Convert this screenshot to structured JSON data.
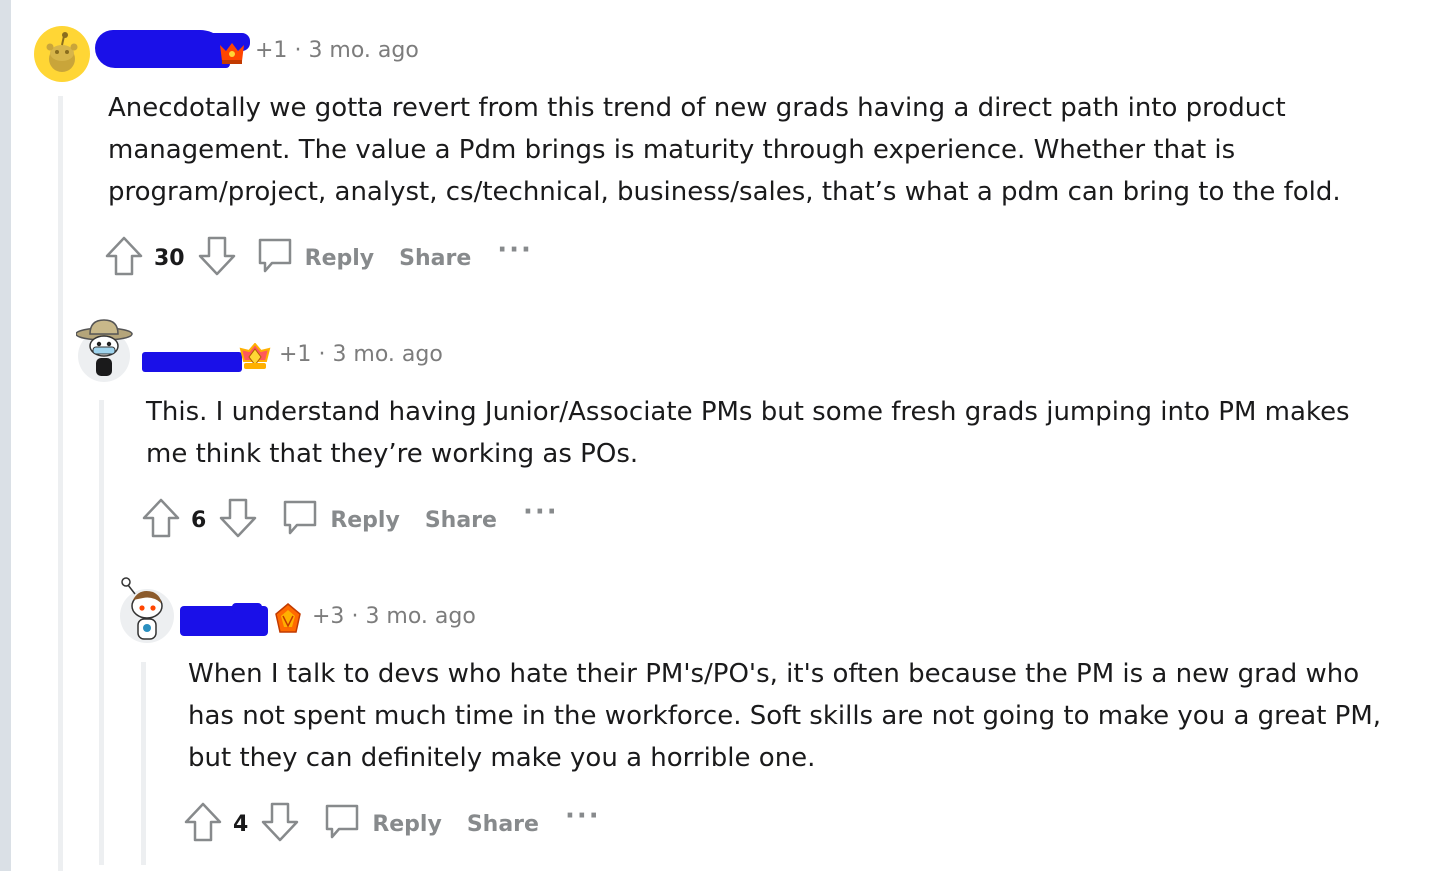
{
  "comments": [
    {
      "points_delta": "+1",
      "age": "3 mo. ago",
      "text": "Anecdotally we gotta revert from this trend of new grads having a direct path into product management. The value a Pdm brings is maturity through experience. Whether that is program/project, analyst, cs/technical, business/sales, that’s what a pdm can bring to the fold.",
      "votes": "30",
      "reply_label": "Reply",
      "share_label": "Share"
    },
    {
      "points_delta": "+1",
      "age": "3 mo. ago",
      "text": "This. I understand having Junior/Associate PMs but some fresh grads jumping into PM makes me think that they’re working as POs.",
      "votes": "6",
      "reply_label": "Reply",
      "share_label": "Share"
    },
    {
      "points_delta": "+3",
      "age": "3 mo. ago",
      "text": "When I talk to devs who hate their PM's/PO's, it's often because the PM is a new grad who has not spent much time in the workforce. Soft skills are not going to make you a great PM, but they can definitely make you a horrible one.",
      "votes": "4",
      "reply_label": "Reply",
      "share_label": "Share"
    }
  ],
  "icons": {
    "upvote": "arrow-up-outline",
    "downvote": "arrow-down-outline",
    "reply": "speech-bubble",
    "more": "ellipsis"
  },
  "colors": {
    "redaction": "#1a10e8",
    "meta_text": "#7c7c7c",
    "action_text": "#878a8c",
    "thread_line": "#edeff1",
    "page_rail": "#dae0e6"
  }
}
